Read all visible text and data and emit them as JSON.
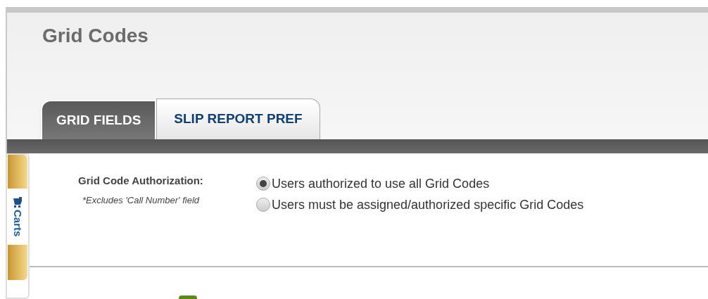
{
  "page_title": "Grid Codes",
  "tabs": [
    {
      "label": "GRID FIELDS",
      "selected": true
    },
    {
      "label": "SLIP REPORT PREF",
      "selected": false
    }
  ],
  "side_tab": {
    "label": "Carts"
  },
  "authorization": {
    "label": "Grid Code Authorization:",
    "note": "*Excludes 'Call Number' field",
    "options": [
      {
        "label": "Users authorized to use all Grid Codes",
        "selected": true
      },
      {
        "label": "Users must be assigned/authorized specific Grid Codes",
        "selected": false
      }
    ]
  }
}
